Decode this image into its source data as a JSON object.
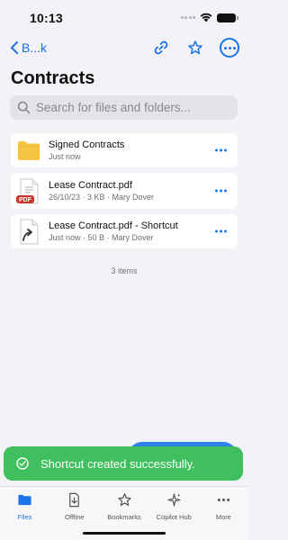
{
  "status_bar": {
    "time": "10:13"
  },
  "nav": {
    "back_label": "B...k"
  },
  "title": "Contracts",
  "search": {
    "placeholder": "Search for files and folders..."
  },
  "items": [
    {
      "name": "Signed Contracts",
      "meta": "Just now",
      "icon": "folder-icon"
    },
    {
      "name": "Lease Contract.pdf",
      "meta": "26/10/23 · 3 KB · Mary Dover",
      "icon": "pdf-file-icon",
      "badge": "PDF"
    },
    {
      "name": "Lease Contract.pdf - Shortcut",
      "meta": "Just now · 50 B · Mary Dover",
      "icon": "shortcut-file-icon"
    }
  ],
  "items_count": "3 items",
  "toast": {
    "message": "Shortcut created successfully."
  },
  "tabs": [
    {
      "label": "Files",
      "icon": "folder-icon",
      "active": true
    },
    {
      "label": "Offline",
      "icon": "offline-download-icon"
    },
    {
      "label": "Bookmarks",
      "icon": "star-icon"
    },
    {
      "label": "Copilot Hub",
      "icon": "sparkle-icon"
    },
    {
      "label": "More",
      "icon": "more-dots-icon"
    }
  ],
  "colors": {
    "accent": "#1a73e8",
    "toast": "#3fbf5e",
    "folder": "#f5c542",
    "pdf_badge": "#c9372c"
  }
}
